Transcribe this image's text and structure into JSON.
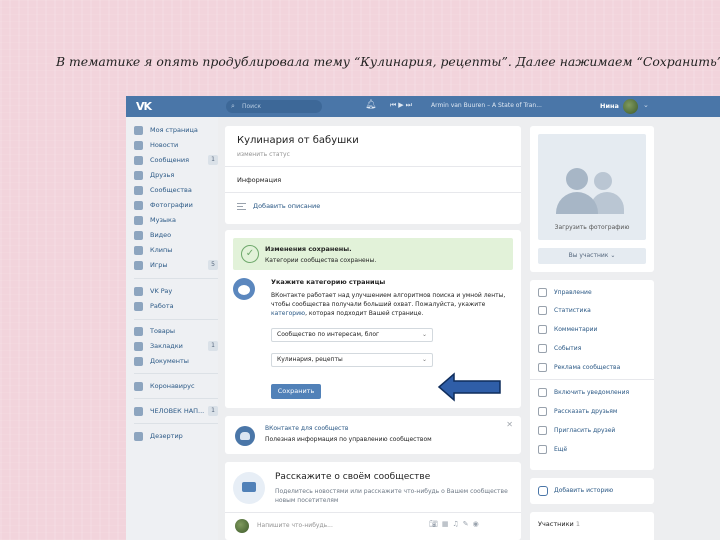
{
  "caption": "В тематике я опять продублировала тему “Кулинария, рецепты”. Далее нажимаем “Сохранить”.",
  "topbar": {
    "logo": "VK",
    "search_placeholder": "Поиск",
    "now_playing": "Armin van Buuren – A State of Tran...",
    "user_name": "Нина"
  },
  "sidebar": {
    "items": [
      {
        "label": "Моя страница",
        "icon": "home-icon"
      },
      {
        "label": "Новости",
        "icon": "news-icon"
      },
      {
        "label": "Сообщения",
        "icon": "message-icon",
        "badge": "1"
      },
      {
        "label": "Друзья",
        "icon": "friends-icon"
      },
      {
        "label": "Сообщества",
        "icon": "groups-icon"
      },
      {
        "label": "Фотографии",
        "icon": "camera-icon"
      },
      {
        "label": "Музыка",
        "icon": "music-icon"
      },
      {
        "label": "Видео",
        "icon": "video-icon"
      },
      {
        "label": "Клипы",
        "icon": "clips-icon"
      },
      {
        "label": "Игры",
        "icon": "games-icon",
        "badge": "5"
      },
      {
        "label": "VK Pay",
        "icon": "vkpay-icon"
      },
      {
        "label": "Работа",
        "icon": "work-icon"
      },
      {
        "label": "Товары",
        "icon": "goods-icon"
      },
      {
        "label": "Закладки",
        "icon": "bookmark-icon",
        "badge": "1"
      },
      {
        "label": "Документы",
        "icon": "docs-icon"
      },
      {
        "label": "Коронавирус",
        "icon": "virus-icon"
      },
      {
        "label": "ЧЕЛОВЕК НАП...",
        "icon": "group-icon",
        "badge": "1"
      },
      {
        "label": "Дезертир",
        "icon": "apps-icon"
      }
    ]
  },
  "header_card": {
    "title": "Кулинария от бабушки",
    "status_link": "изменить статус",
    "info_label": "Информация",
    "add_description": "Добавить описание"
  },
  "saved_notice": {
    "title": "Изменения сохранены.",
    "subtitle": "Категории сообщества сохранены."
  },
  "category": {
    "title": "Укажите категорию страницы",
    "text_before": "ВКонтакте работает над улучшением алгоритмов поиска и умной ленты, чтобы сообщества получали больший охват. Пожалуйста, укажите ",
    "link": "категорию",
    "text_after": ", которая подходит Вашей странице.",
    "select1": "Сообщество по интересам, блог",
    "select2": "Кулинария, рецепты",
    "save_button": "Сохранить"
  },
  "promo": {
    "title": "ВКонтакте для сообществ",
    "subtitle": "Полезная информация по управлению сообществом"
  },
  "tell": {
    "title": "Расскажите о своём сообществе",
    "subtitle": "Поделитесь новостями или расскажите что-нибудь о Вашем сообществе новым посетителям",
    "post_placeholder": "Напишите что-нибудь..."
  },
  "right": {
    "upload_photo": "Загрузить фотографию",
    "member_button": "Вы участник ⌄",
    "menu": [
      {
        "label": "Управление",
        "icon": "gear-icon"
      },
      {
        "label": "Статистика",
        "icon": "stats-icon"
      },
      {
        "label": "Комментарии",
        "icon": "comments-icon"
      },
      {
        "label": "События",
        "icon": "events-icon"
      },
      {
        "label": "Реклама сообщества",
        "icon": "ads-icon"
      },
      {
        "label": "Включить уведомления",
        "icon": "bell-icon"
      },
      {
        "label": "Рассказать друзьям",
        "icon": "share-icon"
      },
      {
        "label": "Пригласить друзей",
        "icon": "invite-icon"
      },
      {
        "label": "Ещё",
        "icon": "more-icon"
      }
    ],
    "add_story": "Добавить историю",
    "members_label": "Участники",
    "members_count": "1"
  }
}
